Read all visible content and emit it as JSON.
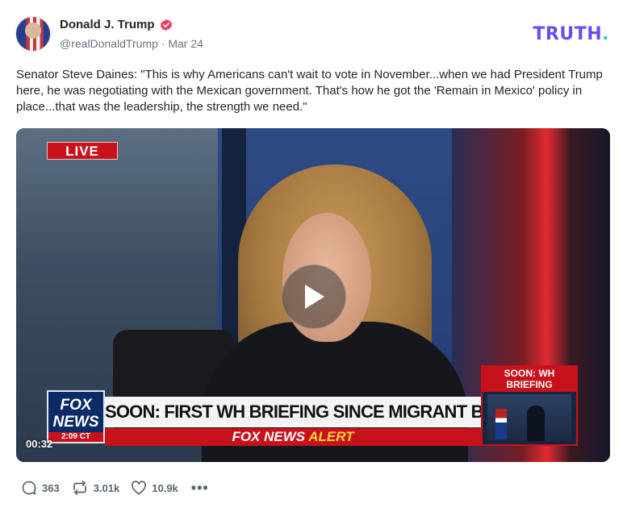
{
  "author": {
    "name": "Donald J. Trump",
    "handle": "@realDonaldTrump",
    "separator": "·",
    "date": "Mar 24"
  },
  "brand": {
    "text": "TRUTH",
    "dot": "."
  },
  "post": {
    "text": "Senator Steve Daines: \"This is why Americans can't wait to vote in November...when we had President Trump here, he was negotiating with the Mexican government. That's how he got the 'Remain in Mexico' policy in place...that was the leadership, the strength we need.\""
  },
  "video": {
    "live_label": "LIVE",
    "logo_line1": "FOX",
    "logo_line2": "NEWS",
    "logo_time": "2:09 CT",
    "headline": "SOON: FIRST WH BRIEFING SINCE MIGRANT BORDER RUSH",
    "alert_prefix": "FOX NEWS",
    "alert_suffix": "ALERT",
    "inset_title": "SOON: WH BRIEFING",
    "duration": "00:32"
  },
  "actions": {
    "replies": "363",
    "retruths": "3.01k",
    "likes": "10.9k",
    "more": "•••"
  },
  "colors": {
    "brand": "#6a4cf5",
    "brand_dot": "#2fd0b0",
    "verified": "#e4405f",
    "fox_red": "#c8121b"
  }
}
